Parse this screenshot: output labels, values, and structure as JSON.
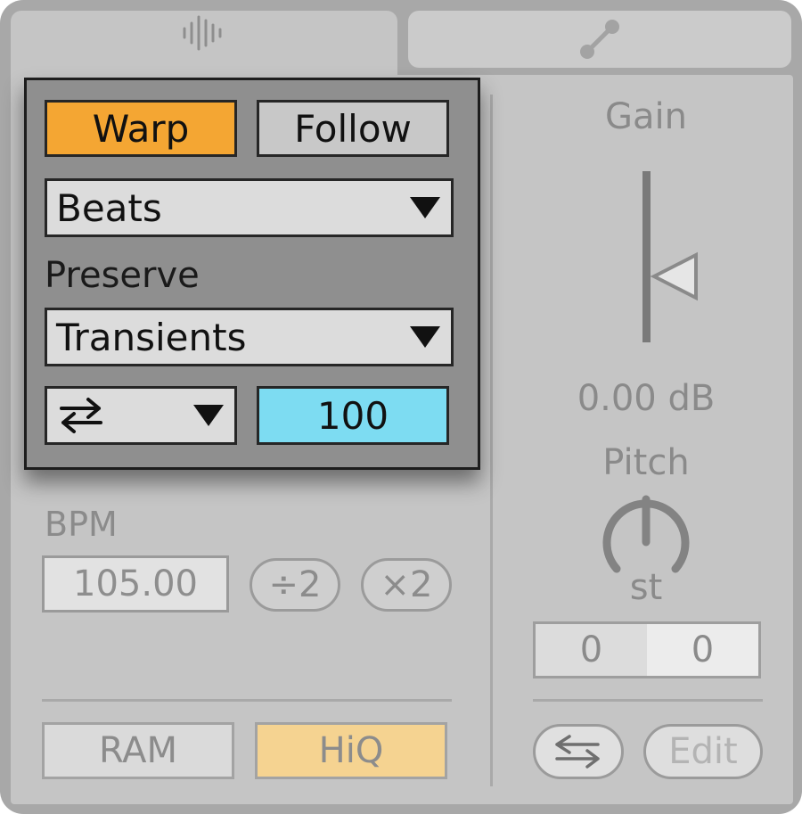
{
  "tabs": [
    {
      "icon": "waveform-icon"
    },
    {
      "icon": "envelope-node-icon"
    }
  ],
  "warp": {
    "warp_label": "Warp",
    "follow_label": "Follow",
    "mode_value": "Beats",
    "preserve_label": "Preserve",
    "preserve_value": "Transients",
    "loop_icon": "loop-mode-icon",
    "amount_value": "100"
  },
  "bpm": {
    "label": "BPM",
    "value": "105.00",
    "half_label": "÷2",
    "double_label": "×2"
  },
  "buttons": {
    "ram_label": "RAM",
    "hiq_label": "HiQ"
  },
  "gain": {
    "label": "Gain",
    "value": "0.00 dB"
  },
  "pitch": {
    "label": "Pitch",
    "unit": "st",
    "coarse": "0",
    "fine": "0"
  },
  "footer": {
    "swap_icon": "swap-arrows-icon",
    "edit_label": "Edit"
  },
  "colors": {
    "warp_active": "#f4a633",
    "hiq_active": "#f5d391",
    "amount_field": "#7ddcf2"
  }
}
